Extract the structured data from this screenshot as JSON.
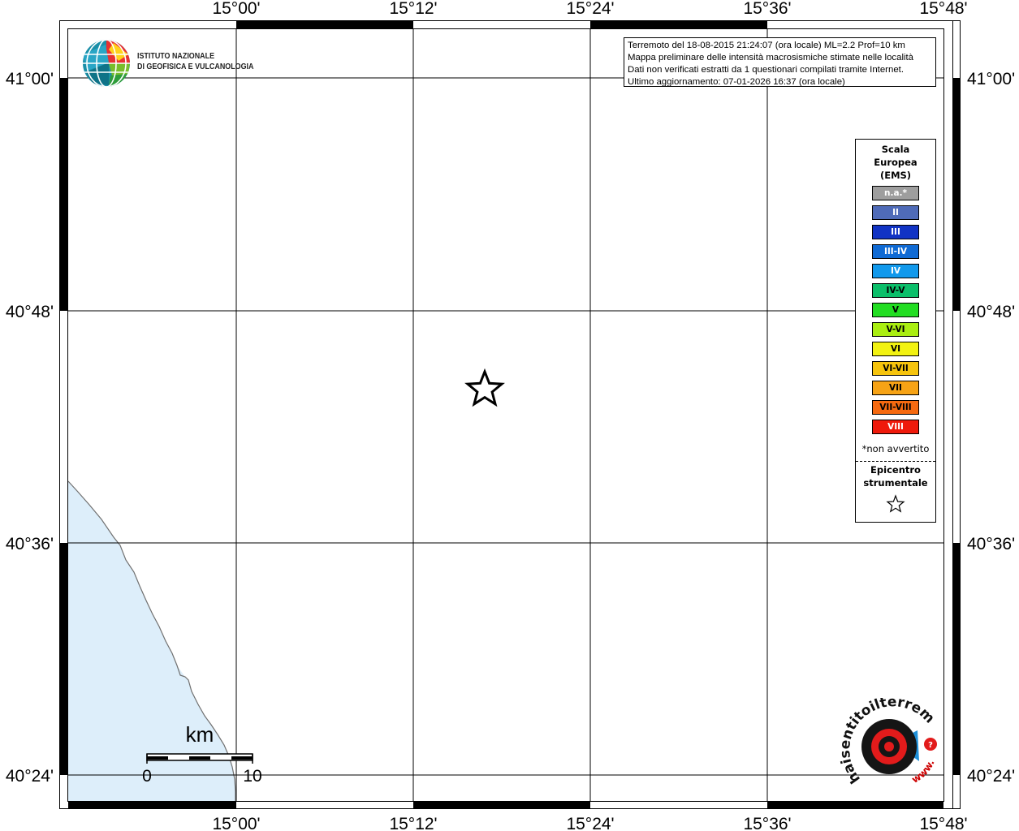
{
  "title_box": {
    "lines": [
      "Terremoto del 18-08-2015 21:24:07 (ora locale) ML=2.2 Prof=10 km",
      "Mappa preliminare delle intensità macrosismiche stimate nelle località",
      "Dati non verificati estratti da 1 questionari compilati tramite Internet.",
      "Ultimo aggiornamento: 07-01-2026 16:37 (ora locale)"
    ]
  },
  "logo": {
    "line1": "ISTITUTO NAZIONALE",
    "line2": "DI GEOFISICA E VULCANOLOGIA"
  },
  "map": {
    "lon_labels": [
      "15°00'",
      "15°12'",
      "15°24'",
      "15°36'",
      "15°48'"
    ],
    "lat_labels": [
      "41°00'",
      "40°48'",
      "40°36'",
      "40°24'"
    ],
    "colors": {
      "sea": "#ddeefa",
      "coast": "#707070",
      "grid": "#000000",
      "frame": "#000000"
    }
  },
  "scale_bar": {
    "unit": "km",
    "min_label": "0",
    "max_label": "10"
  },
  "legend": {
    "title": [
      "Scala",
      "Europea",
      "(EMS)"
    ],
    "items": [
      {
        "label": "n.a.*",
        "color": "#9e9e9e"
      },
      {
        "label": "II",
        "color": "#4f6bb8"
      },
      {
        "label": "III",
        "color": "#1133c4"
      },
      {
        "label": "III-IV",
        "color": "#0f6ad4"
      },
      {
        "label": "IV",
        "color": "#1199ec"
      },
      {
        "label": "IV-V",
        "color": "#0bbf6a"
      },
      {
        "label": "V",
        "color": "#22dd22"
      },
      {
        "label": "V-VI",
        "color": "#aaee11"
      },
      {
        "label": "VI",
        "color": "#f2f211"
      },
      {
        "label": "VI-VII",
        "color": "#f6c40d"
      },
      {
        "label": "VII",
        "color": "#f7a315"
      },
      {
        "label": "VII-VIII",
        "color": "#f66a10"
      },
      {
        "label": "VIII",
        "color": "#ef1a0b"
      }
    ],
    "note": "*non avvertito",
    "epicenter_title": [
      "Epicentro",
      "strumentale"
    ],
    "epicenter_icon": "star-outline-icon"
  },
  "epicenter": {
    "icon": "star-outline-icon",
    "lon": 15.263,
    "lat": 40.707
  },
  "badge": {
    "text": "haisentitoilterremoto.it",
    "www": "www."
  }
}
